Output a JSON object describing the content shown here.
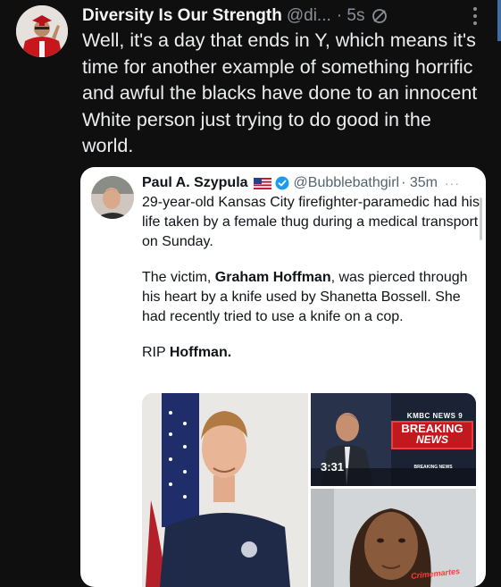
{
  "post": {
    "display_name": "Diversity Is Our Strength",
    "handle": "@di...",
    "time": "· 5s",
    "text": "Well, it's a day that ends in Y, which means it's time for another example of something horrific and awful the blacks have done to an innocent White person just trying to do good in the world."
  },
  "quote": {
    "display_name": "Paul A. Szypula",
    "handle": "@Bubblebathgirl",
    "time": "· 35m",
    "more": "···",
    "para1": "29-year-old Kansas City firefighter-paramedic had his life taken by a female thug during a medical transport on Sunday.",
    "para2_prefix": "The victim, ",
    "para2_bold": "Graham Hoffman",
    "para2_suffix": ", was pierced through his heart by a knife used by Shanetta Bossell. She had recently tried to use a knife on a cop.",
    "para3_prefix": "RIP ",
    "para3_bold": "Hoffman."
  },
  "media": {
    "news_logo": "KMBC NEWS 9",
    "breaking": "BREAKING",
    "news": "NEWS",
    "time": "3:31",
    "ticker": "BREAKING NEWS",
    "watermark": "Crimemartes"
  },
  "icons": {
    "globe": "globe-icon",
    "more": "more-vertical-icon",
    "flag": "us-flag-icon",
    "verified": "verified-badge-icon"
  },
  "colors": {
    "background": "#0f0f10",
    "verified": "#1d9bf0",
    "breaking_red": "#c0191e"
  }
}
